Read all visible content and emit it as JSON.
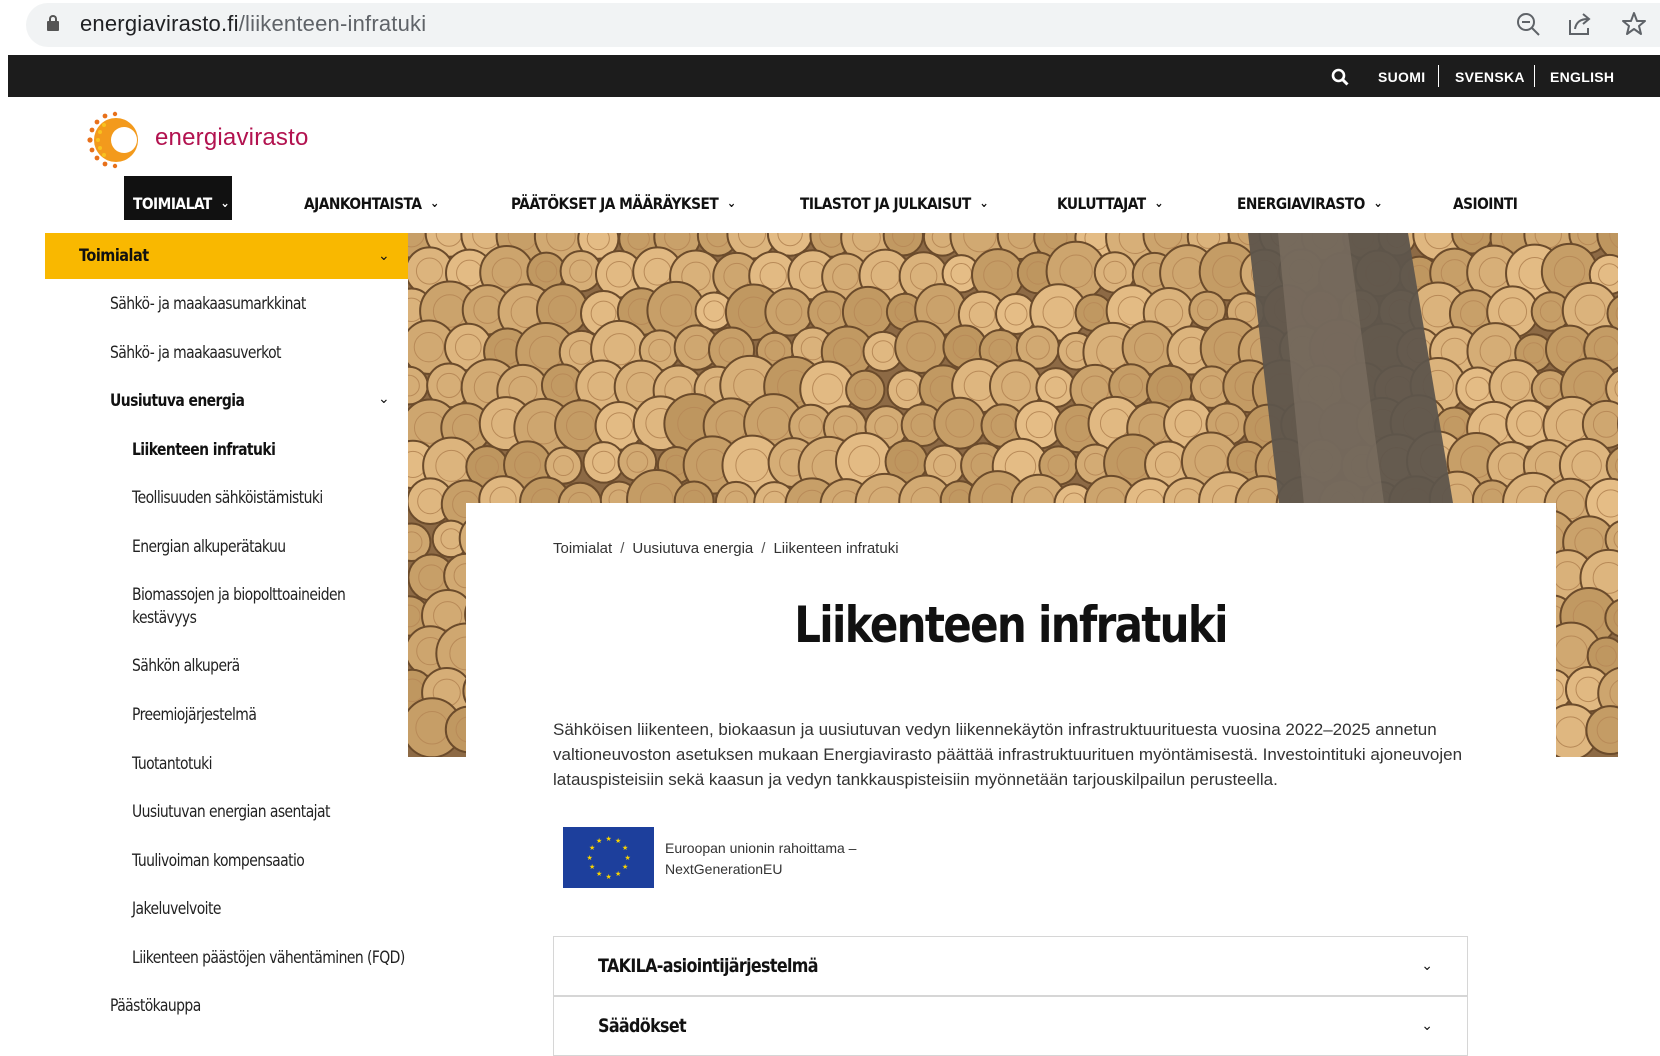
{
  "browser": {
    "url_host": "energiavirasto.fi",
    "url_path": "/liikenteen-infratuki",
    "icons": [
      "lock-icon",
      "zoom-icon",
      "share-icon",
      "star-icon"
    ]
  },
  "topbar": {
    "languages": [
      "SUOMI",
      "SVENSKA",
      "ENGLISH"
    ]
  },
  "header": {
    "logo_text": "energiavirasto",
    "nav": [
      {
        "label": "TOIMIALAT",
        "active": true
      },
      {
        "label": "AJANKOHTAISTA"
      },
      {
        "label": "PÄÄTÖKSET JA MÄÄRÄYKSET"
      },
      {
        "label": "TILASTOT JA JULKAISUT"
      },
      {
        "label": "KULUTTAJAT"
      },
      {
        "label": "ENERGIAVIRASTO"
      },
      {
        "label": "ASIOINTI"
      }
    ]
  },
  "sidebar": {
    "heading": "Toimialat",
    "items": [
      "Sähkö- ja maakaasumarkkinat",
      "Sähkö- ja maakaasuverkot",
      "Uusiutuva energia",
      "Liikenteen infratuki",
      "Teollisuuden sähköistämistuki",
      "Energian alkuperätakuu",
      "Biomassojen ja biopolttoaineiden kestävyys",
      "Sähkön alkuperä",
      "Preemiojärjestelmä",
      "Tuotantotuki",
      "Uusiutuvan energian asentajat",
      "Tuulivoiman kompensaatio",
      "Jakeluvelvoite",
      "Liikenteen päästöjen vähentäminen (FQD)",
      "Päästökauppa"
    ]
  },
  "main": {
    "breadcrumb": [
      "Toimialat",
      "Uusiutuva energia",
      "Liikenteen infratuki"
    ],
    "breadcrumb_sep": "/",
    "title": "Liikenteen infratuki",
    "intro": "Sähköisen liikenteen, biokaasun ja uusiutuvan vedyn liikennekäytön infrastruktuurituesta vuosina 2022–2025 annetun valtioneuvoston asetuksen mukaan Energiavirasto päättää infrastruktuurituen myöntämisestä. Investointituki ajoneuvojen latauspisteisiin sekä kaasun ja vedyn tankkauspisteisiin myönnetään tarjouskilpailun perusteella.",
    "eu_line1": "Euroopan unionin rahoittama –",
    "eu_line2": "NextGenerationEU",
    "accordions": [
      "TAKILA-asiointijärjestelmä",
      "Säädökset"
    ]
  },
  "colors": {
    "accent_yellow": "#f9b800",
    "logo_magenta": "#b2124f",
    "dark_strip": "#1c1c1c",
    "eu_blue": "#1d3f9c"
  }
}
